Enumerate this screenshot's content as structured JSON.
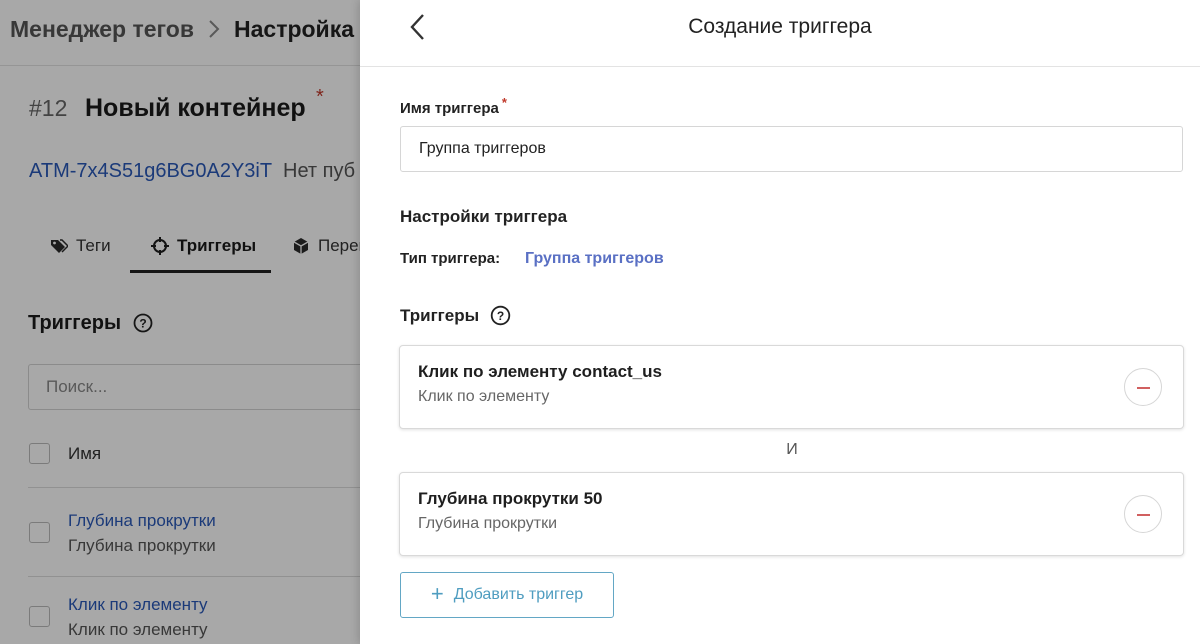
{
  "background": {
    "breadcrumb": {
      "root": "Менеджер тегов",
      "current": "Настройка"
    },
    "container": {
      "number": "#12",
      "name": "Новый контейнер",
      "required_mark": "*",
      "id": "ATM-7x4S51g6BG0A2Y3iT",
      "publish_status": "Нет пуб"
    },
    "tabs": [
      {
        "label": "Теги",
        "icon": "tag-icon"
      },
      {
        "label": "Триггеры",
        "icon": "crosshair-icon",
        "active": true
      },
      {
        "label": "Перем",
        "icon": "cube-icon"
      }
    ],
    "section_title": "Триггеры",
    "search_placeholder": "Поиск...",
    "table": {
      "column_name": "Имя",
      "rows": [
        {
          "title": "Глубина прокрутки",
          "type": "Глубина прокрутки"
        },
        {
          "title": "Клик по элементу",
          "type": "Клик по элементу"
        }
      ]
    }
  },
  "drawer": {
    "title": "Создание триггера",
    "name_label": "Имя триггера",
    "required_mark": "*",
    "name_value": "Группа триггеров",
    "settings_title": "Настройки триггера",
    "type_label": "Тип триггера:",
    "type_value": "Группа триггеров",
    "triggers_title": "Триггеры",
    "and_text": "И",
    "triggers": [
      {
        "title": "Клик по элементу contact_us",
        "type": "Клик по элементу"
      },
      {
        "title": "Глубина прокрутки 50",
        "type": "Глубина прокрутки"
      }
    ],
    "add_button": "Добавить триггер"
  },
  "colors": {
    "accent_link": "#5a70c4",
    "add_button": "#4f9dc0",
    "remove": "#d16060",
    "required": "#c0392b"
  }
}
